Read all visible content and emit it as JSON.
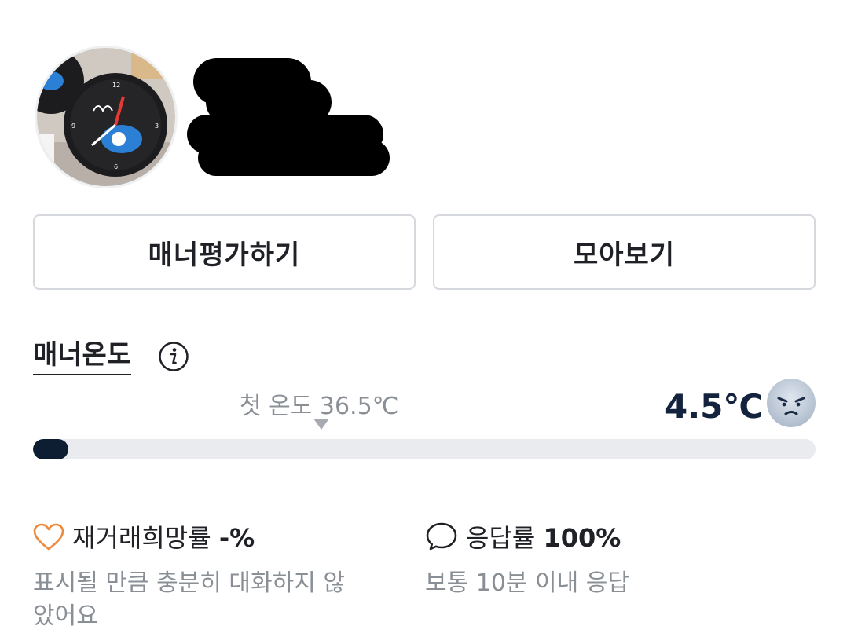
{
  "profile": {
    "avatar_icon": "profile-photo-clock",
    "name_redacted": true
  },
  "actions": {
    "rate_manner_label": "매너평가하기",
    "collection_label": "모아보기"
  },
  "manner": {
    "title": "매너온도",
    "info_icon": "info-icon",
    "first_temperature_label": "첫 온도 36.5℃",
    "current_temperature": "4.5℃",
    "temperature_value": 4.5,
    "mood_icon": "angry-face-icon",
    "bar_fill_percent": 4.5,
    "bar_color": "#0d1e33"
  },
  "stats": {
    "rebuy": {
      "icon": "heart-icon",
      "label": "재거래희망률",
      "value": "-%",
      "description": "표시될 만큼 충분히 대화하지 않았어요"
    },
    "response": {
      "icon": "chat-bubble-icon",
      "label": "응답률",
      "value": "100%",
      "description": "보통 10분 이내 응답"
    }
  }
}
